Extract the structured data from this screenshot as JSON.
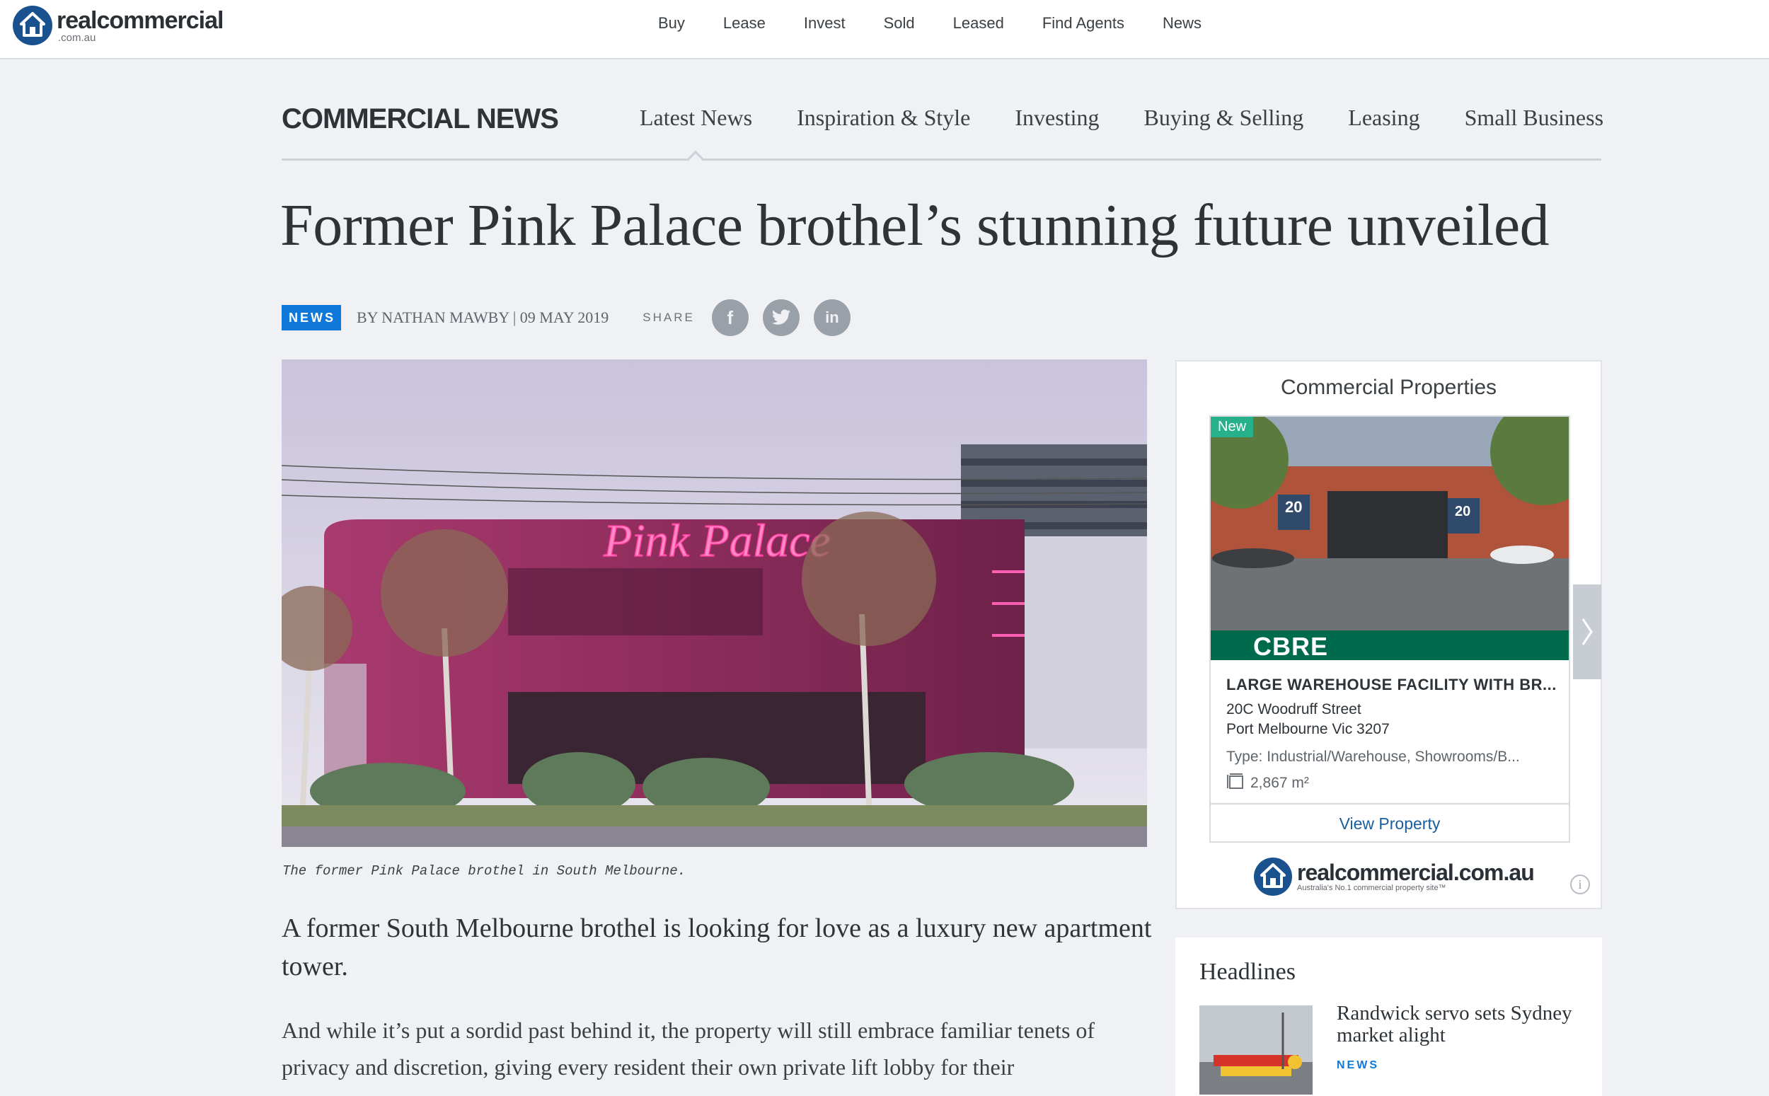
{
  "brand": {
    "name": "realcommercial",
    "domain_suffix": ".com.au",
    "color": "#19528f"
  },
  "top_nav": [
    "Buy",
    "Lease",
    "Invest",
    "Sold",
    "Leased",
    "Find Agents",
    "News"
  ],
  "section": {
    "title": "COMMERCIAL NEWS",
    "tabs": [
      "Latest News",
      "Inspiration & Style",
      "Investing",
      "Buying & Selling",
      "Leasing",
      "Small Business"
    ],
    "active_tab": "Latest News"
  },
  "article": {
    "headline": "Former Pink Palace brothel’s stunning future unveiled",
    "badge": "NEWS",
    "byline": "BY NATHAN MAWBY | 09 MAY 2019",
    "share_label": "SHARE",
    "share_icons": [
      "facebook-icon",
      "twitter-icon",
      "linkedin-icon"
    ],
    "hero_sign_text": "Pink Palace",
    "caption": "The former Pink Palace brothel in South Melbourne.",
    "lead": "A former South Melbourne brothel is looking for love as a luxury new apartment tower.",
    "paragraph": "And while it’s put a sordid past behind it, the property will still embrace familiar tenets of privacy and discretion, giving every resident their own private lift lobby for their"
  },
  "property_widget": {
    "title": "Commercial Properties",
    "new_tag": "New",
    "sign_number": "20",
    "agency": "CBRE",
    "agency_color": "#006a4d",
    "name": "LARGE WAREHOUSE FACILITY WITH BR...",
    "address_line1": "20C Woodruff Street",
    "address_line2": "Port Melbourne Vic 3207",
    "type": "Type: Industrial/Warehouse, Showrooms/B...",
    "area": "2,867 m²",
    "cta": "View Property",
    "footer_brand": "realcommercial.com.au",
    "footer_tagline": "Australia's No.1 commercial property site™",
    "info_icon": "i"
  },
  "headlines": {
    "title": "Headlines",
    "items": [
      {
        "title": "Randwick servo sets Sydney market alight",
        "tag": "NEWS"
      }
    ]
  },
  "colors": {
    "accent_blue": "#0f78d8",
    "link_blue": "#1a5e9e",
    "new_green": "#26b18b"
  }
}
